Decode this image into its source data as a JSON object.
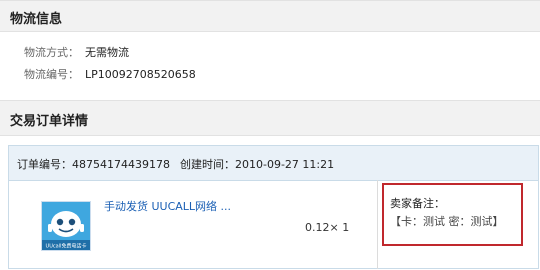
{
  "logistics": {
    "title": "物流信息",
    "method_label": "物流方式：",
    "method_value": "无需物流",
    "number_label": "物流编号：",
    "number_value": "LP10092708520658"
  },
  "order": {
    "section_title": "交易订单详情",
    "number_label": "订单编号：",
    "number_value": "48754174439178",
    "created_label": "创建时间：",
    "created_value": "2010-09-27 11:21",
    "product_title": "手动发货 UUCALL网络 ...",
    "product_thumb_caption": "UUcall免费电话卡",
    "price_qty": "0.12× 1",
    "note_label": "卖家备注：",
    "note_value": "【卡：测试 密：测试】"
  },
  "colors": {
    "link": "#1a5fb4",
    "note_border": "#c0282d",
    "order_head_bg": "#e9f1f8"
  }
}
